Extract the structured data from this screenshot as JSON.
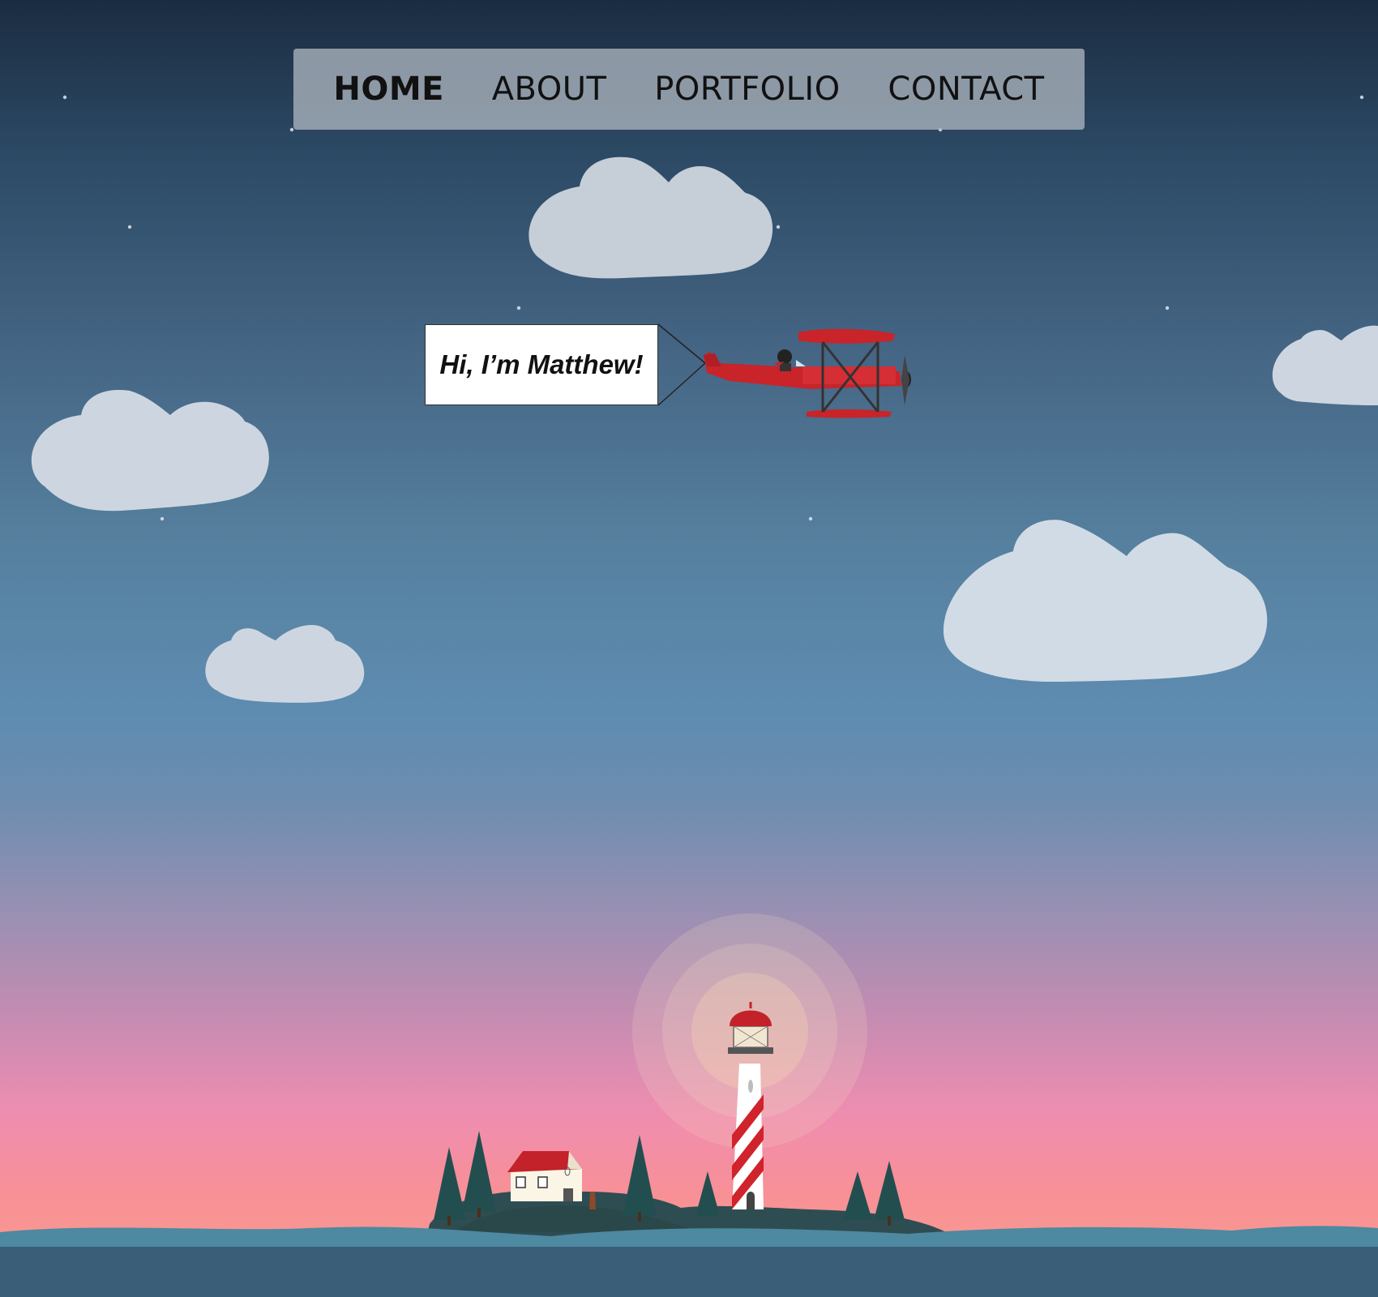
{
  "nav": {
    "items": [
      {
        "label": "HOME",
        "active": true
      },
      {
        "label": "ABOUT",
        "active": false
      },
      {
        "label": "PORTFOLIO",
        "active": false
      },
      {
        "label": "CONTACT",
        "active": false
      }
    ]
  },
  "banner": {
    "text": "Hi, I’m Matthew!"
  },
  "colors": {
    "sky_top": "#1b2c41",
    "sky_mid": "#5e8cb1",
    "sky_horizon": "#f8909a",
    "cloud": "#cfd9e3",
    "plane": "#c8242a",
    "lighthouse_stripe": "#d0232c",
    "water": "#3a5d78",
    "wave": "#4d8aa0",
    "island": "#2d4b4e",
    "tree": "#234e50",
    "house_roof": "#c3222b"
  }
}
